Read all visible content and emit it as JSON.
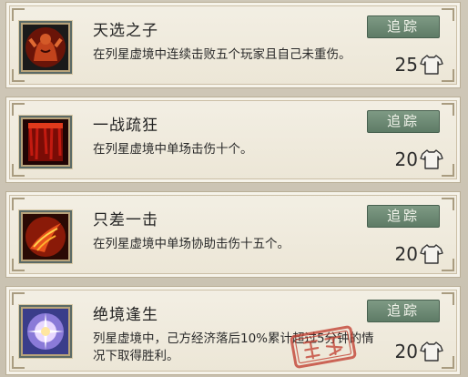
{
  "achievements": [
    {
      "title": "天选之子",
      "description": "在列星虚境中连续击败五个玩家且自己未重伤。",
      "track_label": "追踪",
      "reward": "25",
      "icon": "enraged-warrior-icon",
      "completed": false
    },
    {
      "title": "一战疏狂",
      "description": "在列星虚境中单场击伤十个。",
      "track_label": "追踪",
      "reward": "20",
      "icon": "blood-curtain-icon",
      "completed": false
    },
    {
      "title": "只差一击",
      "description": "在列星虚境中单场协助击伤十五个。",
      "track_label": "追踪",
      "reward": "20",
      "icon": "flame-claw-icon",
      "completed": false
    },
    {
      "title": "绝境逢生",
      "description": "列星虚境中，己方经济落后10%累计超过5分钟的情况下取得胜利。",
      "track_label": "追踪",
      "reward": "20",
      "icon": "radiant-burst-icon",
      "completed": true
    }
  ],
  "reward_icon": "shirt-icon",
  "colors": {
    "track_button": "#6b8872",
    "card_bg": "#efeadf",
    "stamp": "#c0392b"
  }
}
